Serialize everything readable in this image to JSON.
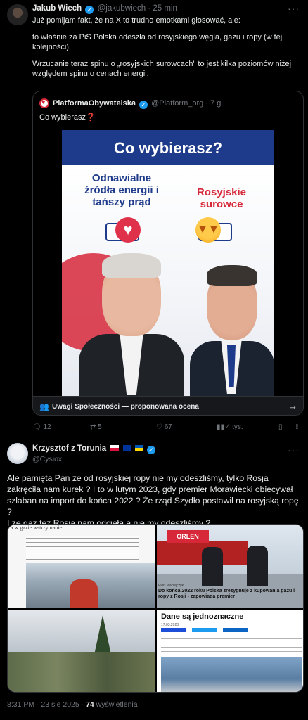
{
  "tweet1": {
    "author": "Jakub Wiech",
    "handle": "@jakubwiech",
    "time": "· 25 min",
    "paragraphs": [
      "Już pomijam fakt, że na X to trudno emotkami głosować, ale:",
      "to właśnie za PiS Polska odeszła od rosyjskiego węgla, gazu i ropy (w tej kolejności).",
      "Wrzucanie teraz spinu o „rosyjskich surowcach\" to jest kilka poziomów niżej względem spinu o cenach energii."
    ],
    "quote": {
      "author": "PlatformaObywatelska",
      "handle": "@Platform_org · 7 g.",
      "text": "Co wybierasz",
      "text_emoji": "❓",
      "poster": {
        "title": "Co wybierasz?",
        "left_label": "Odnawialne źródła energii i tańszy prąd",
        "right_label": "Rosyjskie surowce"
      },
      "community_note": "Uwagi Społeczności — proponowana ocena"
    },
    "actions": {
      "replies": "12",
      "retweets": "5",
      "likes": "67",
      "views": "4 tys."
    }
  },
  "tweet2": {
    "author": "Krzysztof z Torunia",
    "handle": "@Cysiox",
    "text_lines": [
      "Ale pamięta Pan że od rosyjskiej ropy nie my odeszliśmy, tylko Rosja zakręciła nam kurek ? I to w lutym 2023, gdy premier Morawiecki obiecywał szlaban na import do końca 2022 ? Że rząd Szydło postawił na rosyjską ropę ?",
      "I że gaz też Rosja nam odcięła a nie my odeszliśmy ?"
    ],
    "images": {
      "img1_title": "a w gazie wstrzymanie",
      "img2_logo": "ORLEN",
      "img2_caption": "Piotr Maciejczyk",
      "img2_headline": "Do końca 2022 roku Polska zrezygnuje z kupowania gazu i ropy z Rosji - zapowiada premier",
      "img4_title": "Dane są jednoznaczne",
      "img4_date": "17.03.2023"
    },
    "timestamp": "8:31 PM · 23 sie 2025 · ",
    "views_count": "74",
    "views_label": " wyświetlenia"
  }
}
